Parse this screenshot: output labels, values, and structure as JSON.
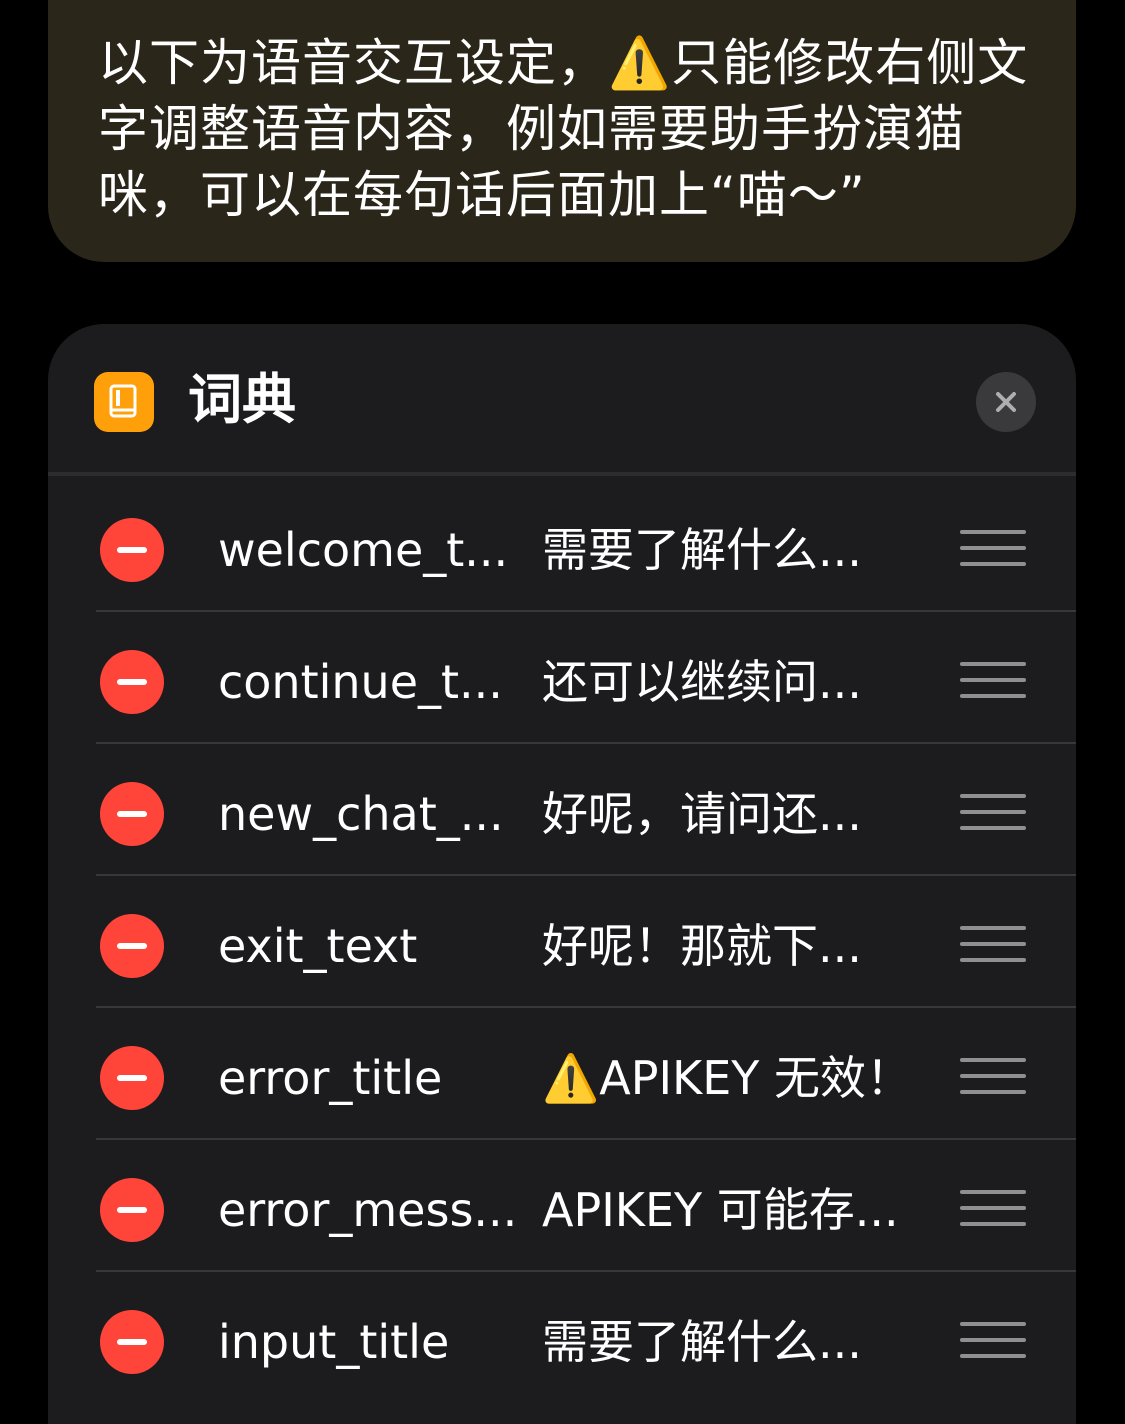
{
  "note": {
    "text": "以下为语音交互设定，⚠️只能修改右侧文字调整语音内容，例如需要助手扮演猫咪，可以在每句话后面加上“喵～”"
  },
  "dictionary": {
    "title": "词典",
    "icon": "book-icon",
    "close_icon": "close-icon",
    "accent_color": "#ff9f0a",
    "delete_color": "#ff453a",
    "rows": [
      {
        "key": "welcome_t...",
        "value": "需要了解什么..."
      },
      {
        "key": "continue_t...",
        "value": "还可以继续问..."
      },
      {
        "key": "new_chat_...",
        "value": "好呢，请问还..."
      },
      {
        "key": "exit_text",
        "value": "好呢！那就下..."
      },
      {
        "key": "error_title",
        "value": "⚠️APIKEY 无效！"
      },
      {
        "key": "error_mess...",
        "value": "APIKEY 可能存..."
      },
      {
        "key": "input_title",
        "value": "需要了解什么..."
      }
    ]
  }
}
